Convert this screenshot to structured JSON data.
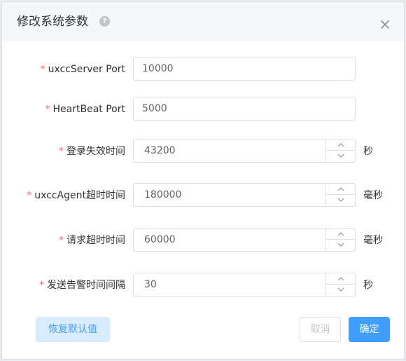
{
  "dialog": {
    "title": "修改系统参数",
    "help_icon": "question-circle-icon",
    "close_icon": "close-icon"
  },
  "form": {
    "fields": [
      {
        "label": "uxccServer Port",
        "value": "10000",
        "required": true,
        "type": "text"
      },
      {
        "label": "HeartBeat Port",
        "value": "5000",
        "required": true,
        "type": "text"
      },
      {
        "label": "登录失效时间",
        "value": "43200",
        "required": true,
        "type": "number",
        "unit": "秒"
      },
      {
        "label": "uxccAgent超时时间",
        "value": "180000",
        "required": true,
        "type": "number",
        "unit": "毫秒"
      },
      {
        "label": "请求超时时间",
        "value": "60000",
        "required": true,
        "type": "number",
        "unit": "毫秒"
      },
      {
        "label": "发送告警时间间隔",
        "value": "30",
        "required": true,
        "type": "number",
        "unit": "秒"
      }
    ],
    "required_mark": "*"
  },
  "footer": {
    "restore_label": "恢复默认值",
    "cancel_label": "取消",
    "ok_label": "确定"
  },
  "colors": {
    "primary": "#409eff",
    "required": "#f56c6c",
    "header_bg": "#f5f7fa"
  }
}
